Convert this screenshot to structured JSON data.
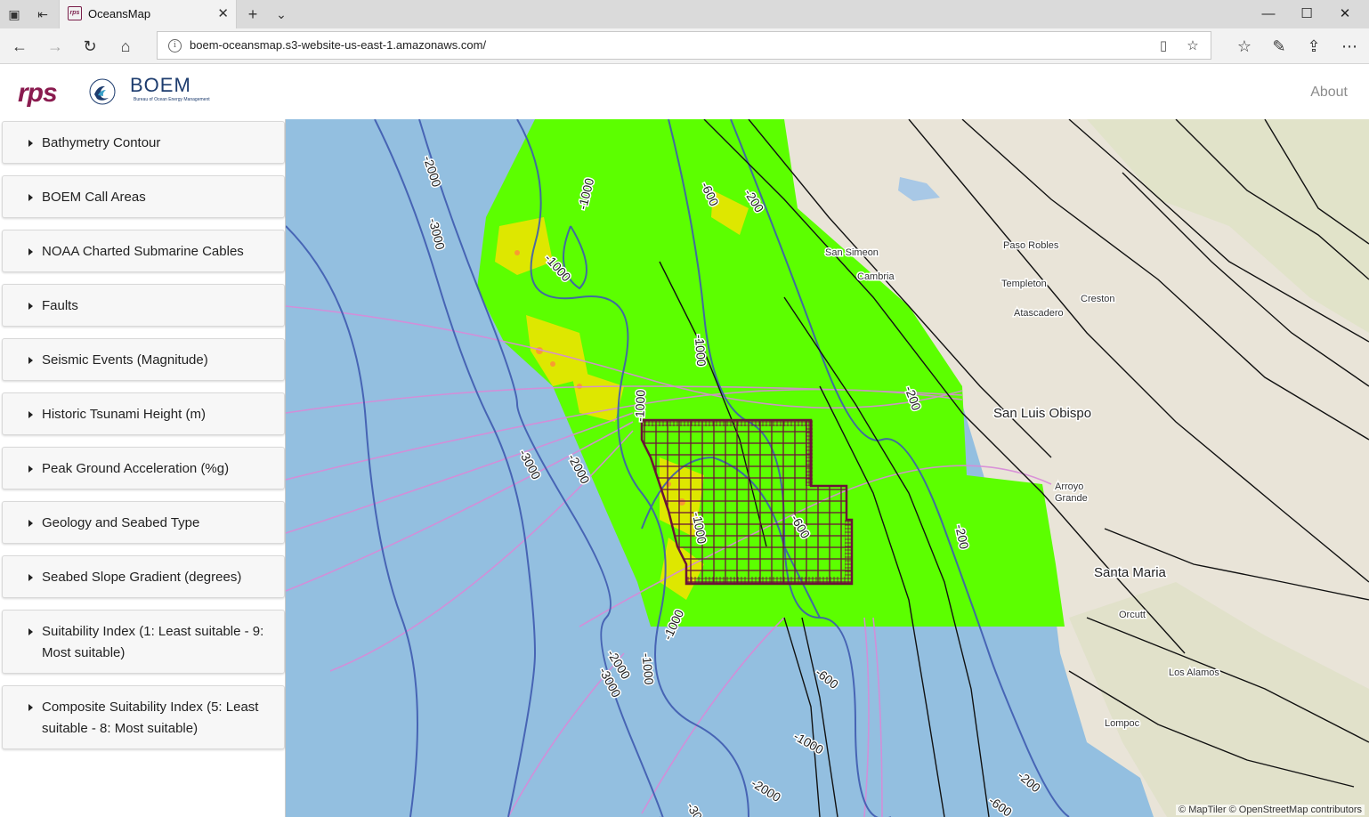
{
  "browser": {
    "tab_title": "OceansMap",
    "url": "boem-oceansmap.s3-website-us-east-1.amazonaws.com/",
    "icons": [
      "tab-actions-icon",
      "set-aside-tabs-icon",
      "new-tab-icon",
      "tab-list-icon",
      "minimize-icon",
      "maximize-icon",
      "close-icon",
      "back-icon",
      "forward-icon",
      "refresh-icon",
      "home-icon",
      "info-icon",
      "reading-view-icon",
      "favorite-star-icon",
      "favorites-icon",
      "notes-icon",
      "share-icon",
      "more-icon"
    ]
  },
  "header": {
    "rps_logo": "rps",
    "boem_logo": "BOEM",
    "boem_subtext": "Bureau of Ocean Energy Management",
    "about": "About"
  },
  "sidebar": {
    "layers": [
      {
        "label": "Bathymetry Contour"
      },
      {
        "label": "BOEM Call Areas"
      },
      {
        "label": "NOAA Charted Submarine Cables"
      },
      {
        "label": "Faults"
      },
      {
        "label": "Seismic Events (Magnitude)"
      },
      {
        "label": "Historic Tsunami Height (m)"
      },
      {
        "label": "Peak Ground Acceleration (%g)"
      },
      {
        "label": "Geology and Seabed Type"
      },
      {
        "label": "Seabed Slope Gradient (degrees)"
      },
      {
        "label": "Suitability Index (1: Least suitable - 9: Most suitable)"
      },
      {
        "label": "Composite Suitability Index (5: Least suitable - 8: Most suitable)"
      }
    ]
  },
  "map": {
    "places": {
      "san_simeon": "San Simeon",
      "cambria": "Cambria",
      "paso_robles": "Paso Robles",
      "templeton": "Templeton",
      "atascadero": "Atascadero",
      "creston": "Creston",
      "san_luis_obispo": "San Luis Obispo",
      "arroyo": "Arroyo",
      "grande": "Grande",
      "santa_maria": "Santa Maria",
      "orcutt": "Orcutt",
      "los_alamos": "Los Alamos",
      "lompoc": "Lompoc"
    },
    "contour_labels": {
      "c1": "-2000",
      "c2": "-3000",
      "c3": "-1000",
      "c4": "-1000",
      "c5": "-600",
      "c6": "-200",
      "c7": "-1000",
      "c8": "-1000",
      "c9": "-200",
      "c10": "-3000",
      "c11": "-2000",
      "c12": "-1000",
      "c13": "-600",
      "c14": "-200",
      "c15": "-1000",
      "c16": "-2000",
      "c17": "-3000",
      "c18": "-1000",
      "c19": "-600",
      "c20": "-1000",
      "c21": "-2000",
      "c22": "-200",
      "c23": "-600",
      "c24": "-30"
    },
    "colors": {
      "ocean": "#93bfe0",
      "land": "#e9e4d8",
      "suitability_green": "#5cff00",
      "call_area_grid": "#6b1238",
      "bathymetry_contour": "#3f5bb0",
      "cable": "#d88ad8",
      "fault": "#111111"
    },
    "attribution": "© MapTiler © OpenStreetMap contributors"
  }
}
